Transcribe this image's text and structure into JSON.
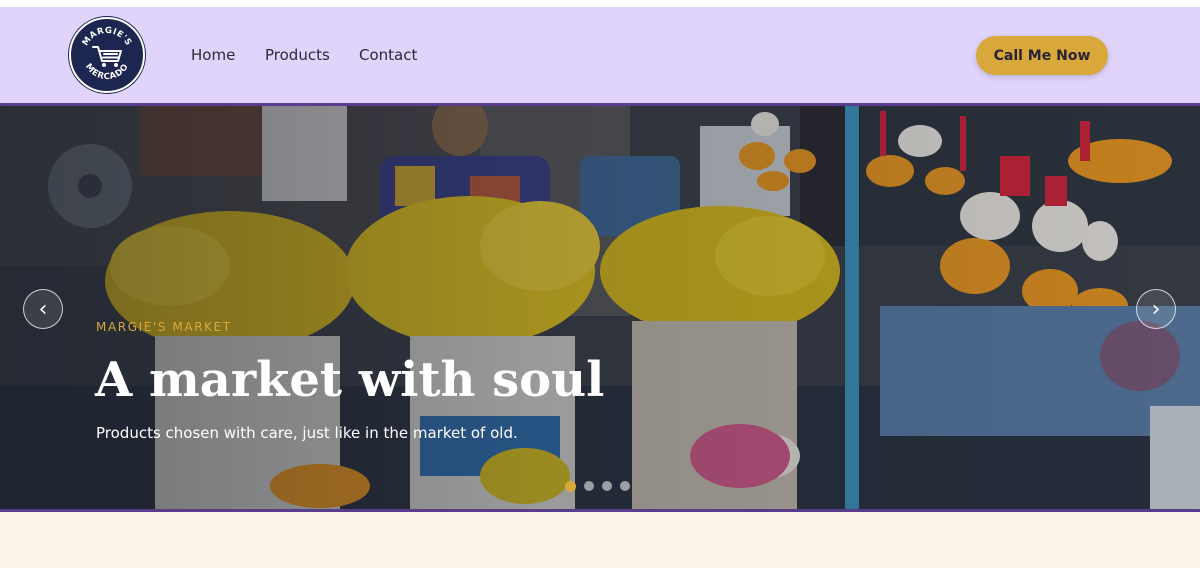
{
  "brand": {
    "name_top": "MARGIE'S",
    "name_bottom": "MERCADO",
    "icon": "shopping-cart-icon",
    "colors": {
      "badge": "#1c2650",
      "ring": "#ffffff"
    }
  },
  "nav": {
    "items": [
      {
        "label": "Home"
      },
      {
        "label": "Products"
      },
      {
        "label": "Contact"
      }
    ]
  },
  "cta": {
    "label": "Call Me Now"
  },
  "hero": {
    "eyebrow": "MARGIE'S MARKET",
    "title": "A market with soul",
    "subtitle": "Products chosen with care, just like in the market of old.",
    "prev_label": "‹",
    "next_label": "›",
    "slides_count": 4,
    "active_slide": 1
  },
  "colors": {
    "header_bg": "#e1d4fb",
    "accent": "#d8a83a",
    "hero_border": "#5a3c8e",
    "page_bg": "#fbf3e8"
  }
}
